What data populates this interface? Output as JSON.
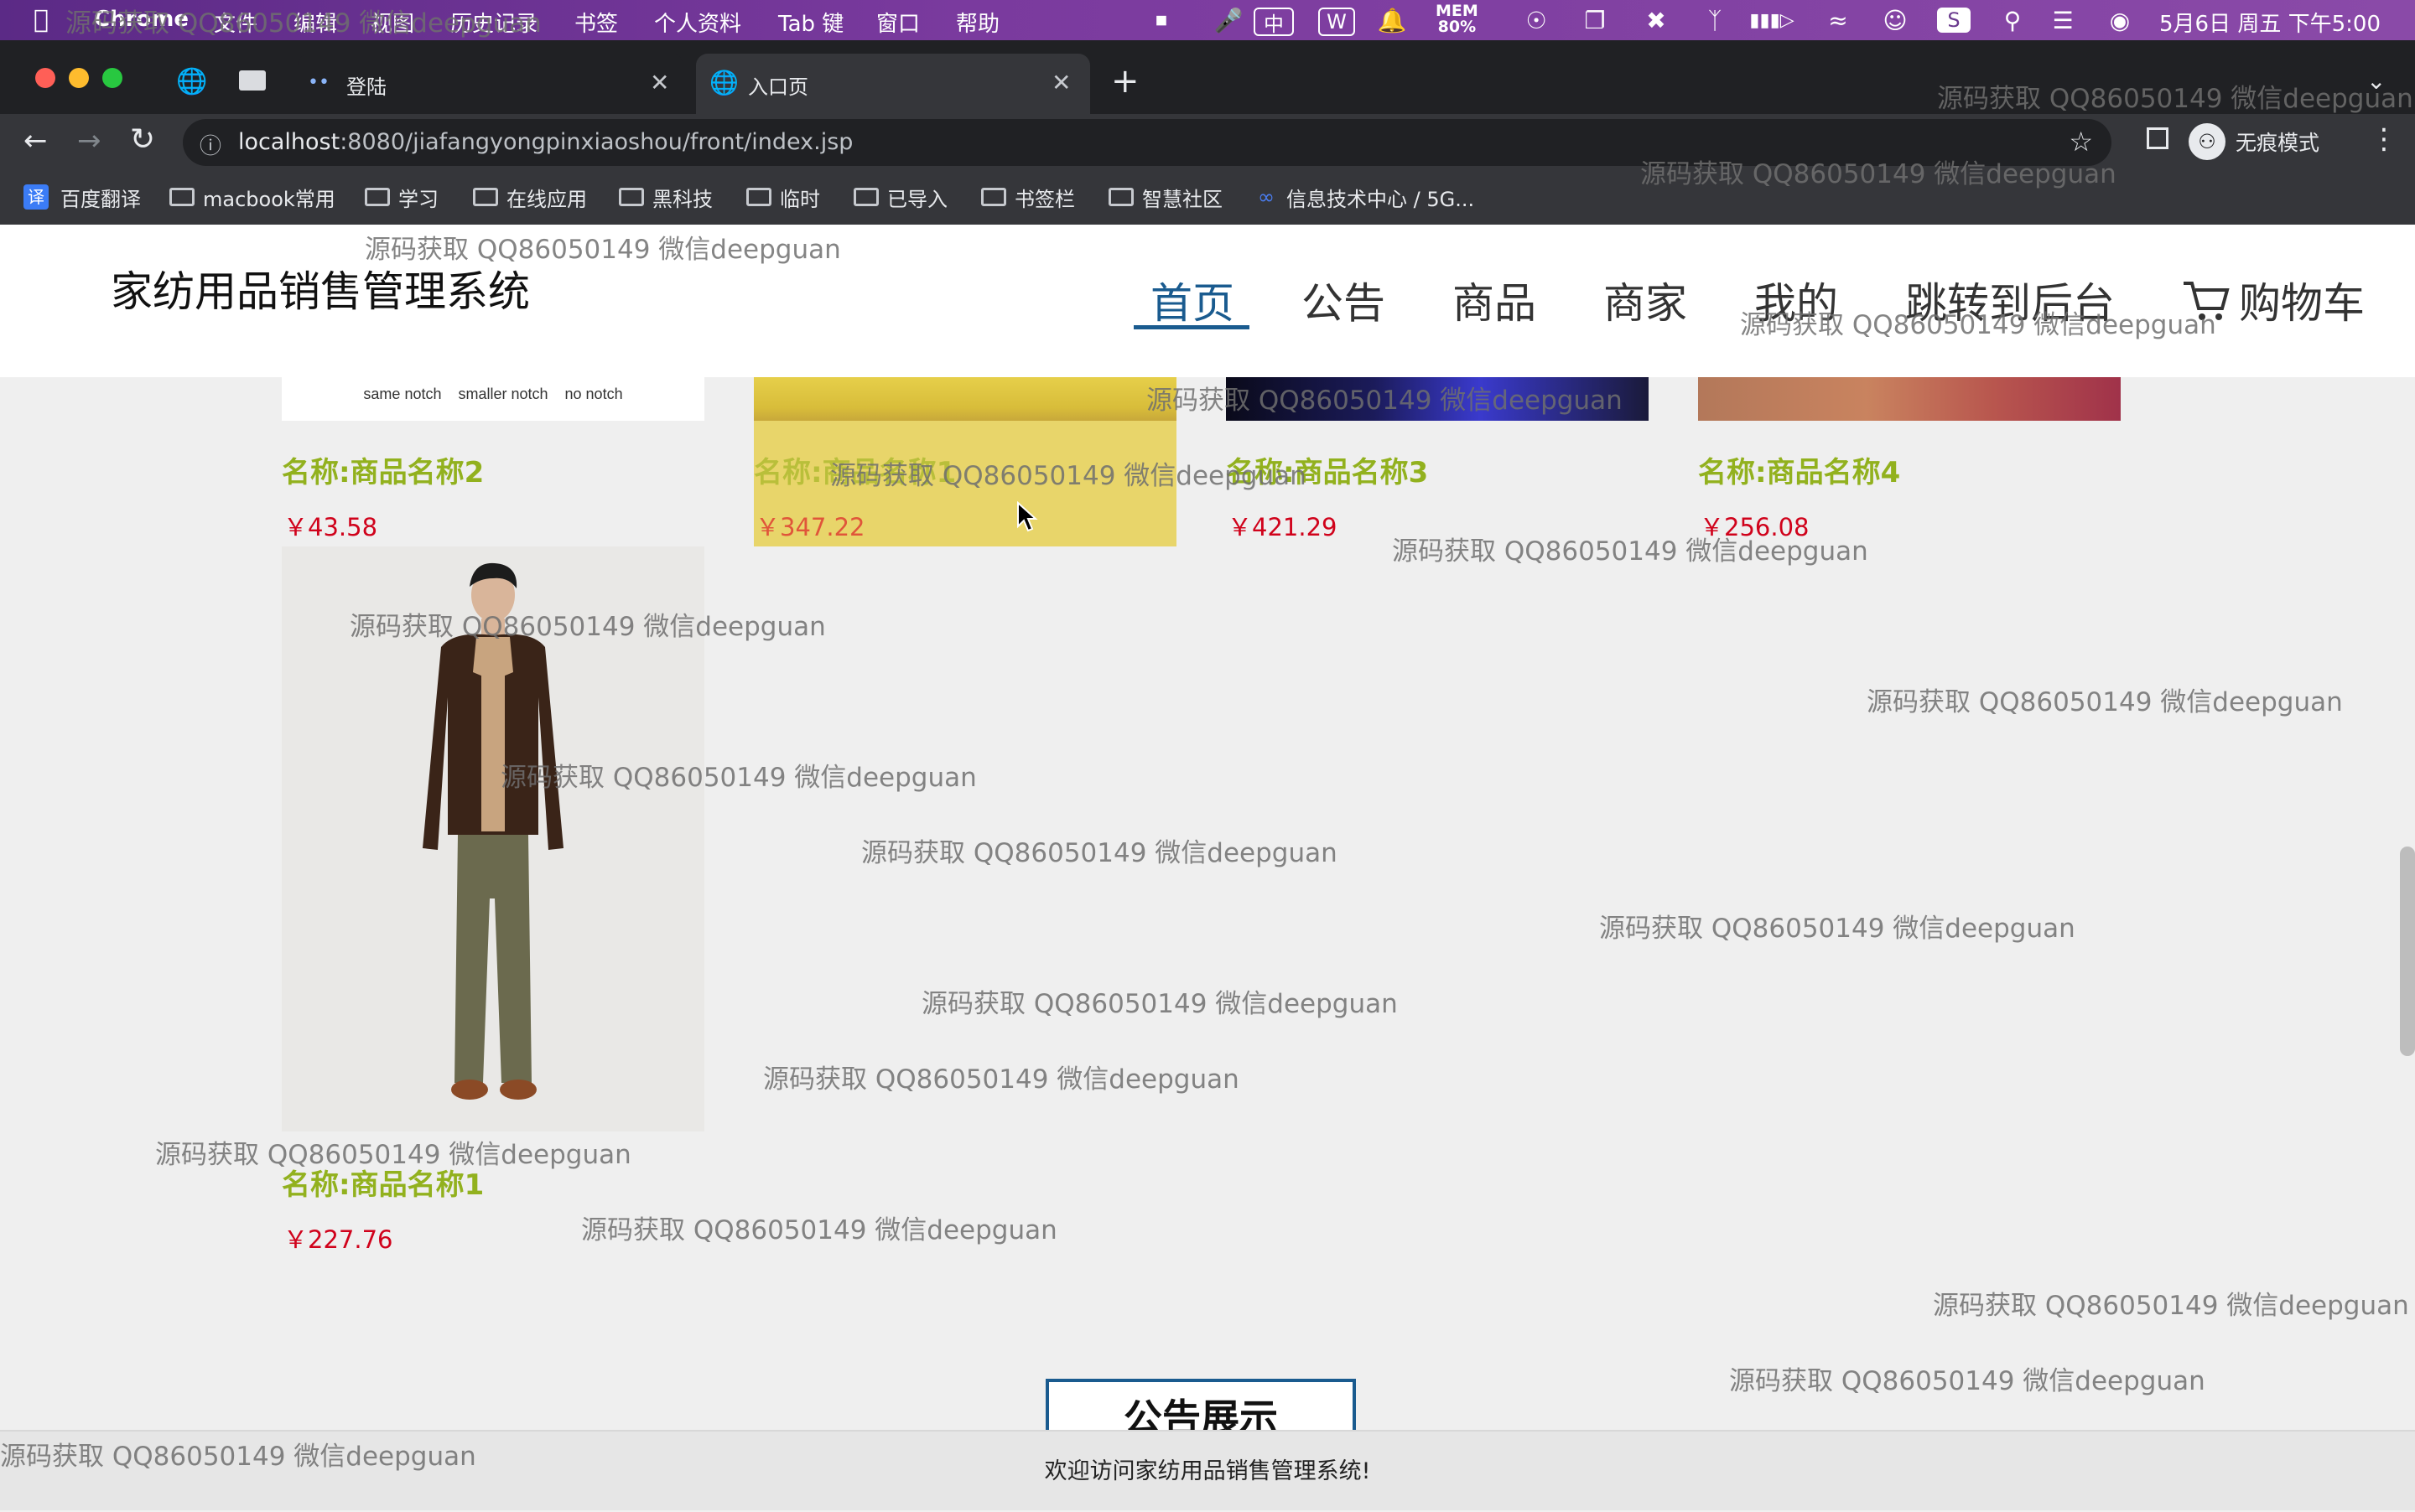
{
  "menubar": {
    "app_name": "Chrome",
    "items": [
      "文件",
      "编辑",
      "视图",
      "历史记录",
      "书签",
      "个人资料",
      "Tab 键",
      "窗口",
      "帮助"
    ],
    "mem_label": "MEM",
    "mem_value": "80%",
    "datetime": "5月6日 周五 下午5:00"
  },
  "tabs": [
    {
      "title": "登陆"
    },
    {
      "title": "入口页"
    }
  ],
  "address": {
    "host": "localhost",
    "path": ":8080/jiafangyongpinxiaoshou/front/index.jsp"
  },
  "incognito_label": "无痕模式",
  "bookmarks": [
    "百度翻译",
    "macbook常用",
    "学习",
    "在线应用",
    "黑科技",
    "临时",
    "已导入",
    "书签栏",
    "智慧社区",
    "信息技术中心 / 5G..."
  ],
  "site": {
    "title": "家纺用品销售管理系统",
    "nav": [
      "首页",
      "公告",
      "商品",
      "商家",
      "我的",
      "跳转到后台"
    ],
    "cart_label": "购物车"
  },
  "products_row": [
    {
      "name": "名称:商品名称2",
      "price": "￥43.58",
      "img_caption": "same notch    smaller notch    no notch"
    },
    {
      "name": "名称:商品名称1",
      "price": "￥347.22"
    },
    {
      "name": "名称:商品名称3",
      "price": "￥421.29"
    },
    {
      "name": "名称:商品名称4",
      "price": "￥256.08"
    }
  ],
  "product_single": {
    "name": "名称:商品名称1",
    "price": "￥227.76"
  },
  "notice_heading": "公告展示",
  "footer_text": "欢迎访问家纺用品销售管理系统!",
  "watermark": "源码获取 QQ86050149 微信deepguan",
  "colors": {
    "accent": "#1a5b8f",
    "product_name": "#92b11e",
    "price": "#d0021b",
    "highlight": "#e8d56a"
  }
}
